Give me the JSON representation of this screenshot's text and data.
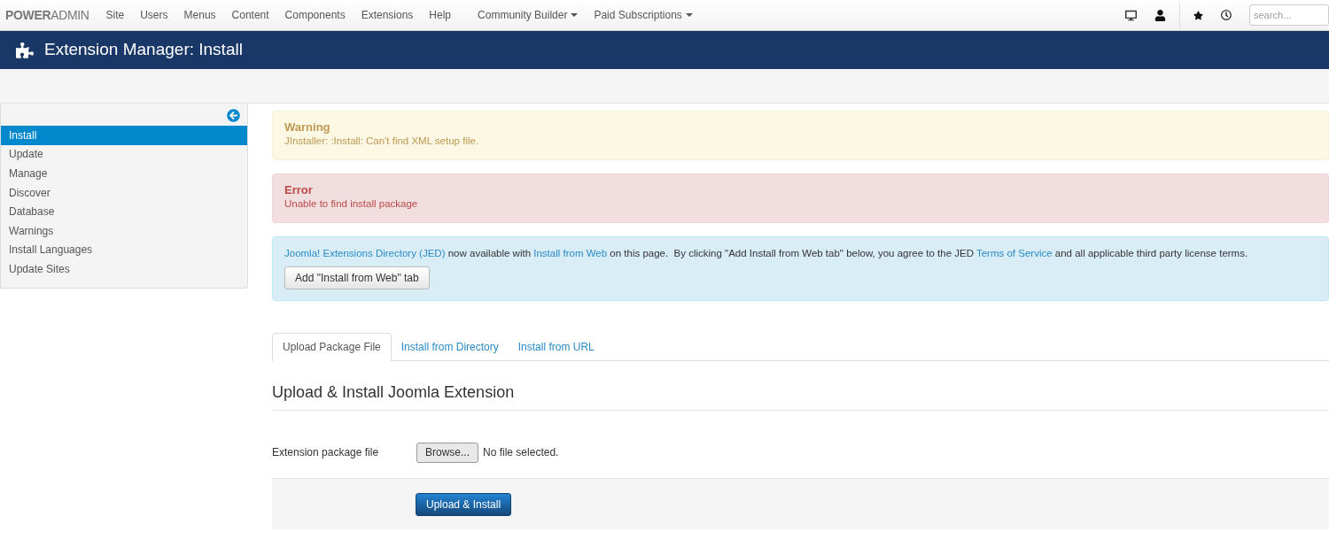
{
  "navbar": {
    "logo": "**POWER**ADMIN",
    "menu": [
      {
        "label": "Site",
        "dropdown": false
      },
      {
        "label": "Users",
        "dropdown": false
      },
      {
        "label": "Menus",
        "dropdown": false
      },
      {
        "label": "Content",
        "dropdown": false
      },
      {
        "label": "Components",
        "dropdown": false
      },
      {
        "label": "Extensions",
        "dropdown": false
      },
      {
        "label": "Help",
        "dropdown": false
      },
      {
        "label": "Community Builder",
        "dropdown": true
      },
      {
        "label": "Paid Subscriptions",
        "dropdown": true
      }
    ],
    "search": {
      "placeholder": "search..."
    }
  },
  "header": {
    "title": "Extension Manager: Install"
  },
  "sidebar": {
    "items": [
      {
        "label": "Install",
        "selected": true
      },
      {
        "label": "Update",
        "selected": false
      },
      {
        "label": "Manage",
        "selected": false
      },
      {
        "label": "Discover",
        "selected": false
      },
      {
        "label": "Database",
        "selected": false
      },
      {
        "label": "Warnings",
        "selected": false
      },
      {
        "label": "Install Languages",
        "selected": false
      },
      {
        "label": "Update Sites",
        "selected": false
      }
    ]
  },
  "alerts": [
    {
      "kind": "warning",
      "heading": "Warning",
      "message": "JInstaller: :Install: Can't find XML setup file."
    },
    {
      "kind": "error",
      "heading": "Error",
      "message": "Unable to find install package"
    }
  ],
  "info": {
    "segments": [
      {
        "kind": "link",
        "text": "Joomla! Extensions Directory (JED)"
      },
      {
        "kind": "text",
        "text": " now available with "
      },
      {
        "kind": "link",
        "text": "Install from Web"
      },
      {
        "kind": "text",
        "text": " on this page.  By clicking \"Add Install from Web tab\" below, you agree to the JED "
      },
      {
        "kind": "link",
        "text": "Terms of Service"
      },
      {
        "kind": "text",
        "text": " and all applicable third party license terms."
      }
    ],
    "button": "Add \"Install from Web\" tab"
  },
  "tabs": [
    {
      "label": "Upload Package File",
      "selected": true
    },
    {
      "label": "Install from Directory",
      "selected": false
    },
    {
      "label": "Install from URL",
      "selected": false
    }
  ],
  "section": {
    "heading": "Upload & Install Joomla Extension",
    "field_label": "Extension package file",
    "browse": "Browse...",
    "file_status": "No file selected.",
    "submit": "Upload & Install"
  }
}
